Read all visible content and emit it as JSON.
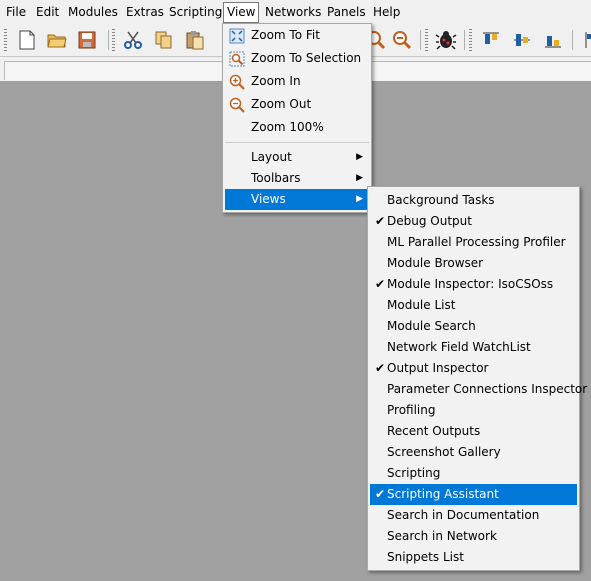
{
  "menubar": [
    "File",
    "Edit",
    "Modules",
    "Extras",
    "Scripting",
    "View",
    "Networks",
    "Panels",
    "Help"
  ],
  "view_menu": {
    "items": [
      {
        "label": "Zoom To Fit",
        "icon": "zoom-to-fit-icon"
      },
      {
        "label": "Zoom To Selection",
        "icon": "zoom-to-selection-icon"
      },
      {
        "label": "Zoom In",
        "icon": "zoom-in-icon"
      },
      {
        "label": "Zoom Out",
        "icon": "zoom-out-icon"
      },
      {
        "label": "Zoom 100%"
      },
      {
        "label": "Layout",
        "submenu": true
      },
      {
        "label": "Toolbars",
        "submenu": true
      },
      {
        "label": "Views",
        "submenu": true,
        "highlighted": true
      }
    ]
  },
  "views_menu": {
    "items": [
      {
        "label": "Background Tasks",
        "checked": false
      },
      {
        "label": "Debug Output",
        "checked": true
      },
      {
        "label": "ML Parallel Processing Profiler",
        "checked": false
      },
      {
        "label": "Module Browser",
        "checked": false
      },
      {
        "label": "Module Inspector: IsoCSOss",
        "checked": true
      },
      {
        "label": "Module List",
        "checked": false
      },
      {
        "label": "Module Search",
        "checked": false
      },
      {
        "label": "Network Field WatchList",
        "checked": false
      },
      {
        "label": "Output Inspector",
        "checked": true
      },
      {
        "label": "Parameter Connections Inspector",
        "checked": false
      },
      {
        "label": "Profiling",
        "checked": false
      },
      {
        "label": "Recent Outputs",
        "checked": false
      },
      {
        "label": "Screenshot Gallery",
        "checked": false
      },
      {
        "label": "Scripting",
        "checked": false
      },
      {
        "label": "Scripting Assistant",
        "checked": true,
        "highlighted": true
      },
      {
        "label": "Search in Documentation",
        "checked": false
      },
      {
        "label": "Search in Network",
        "checked": false
      },
      {
        "label": "Snippets List",
        "checked": false
      }
    ]
  },
  "colors": {
    "highlight": "#0078d7",
    "workspace": "#a0a0a0",
    "menu_bg": "#f2f2f2"
  }
}
